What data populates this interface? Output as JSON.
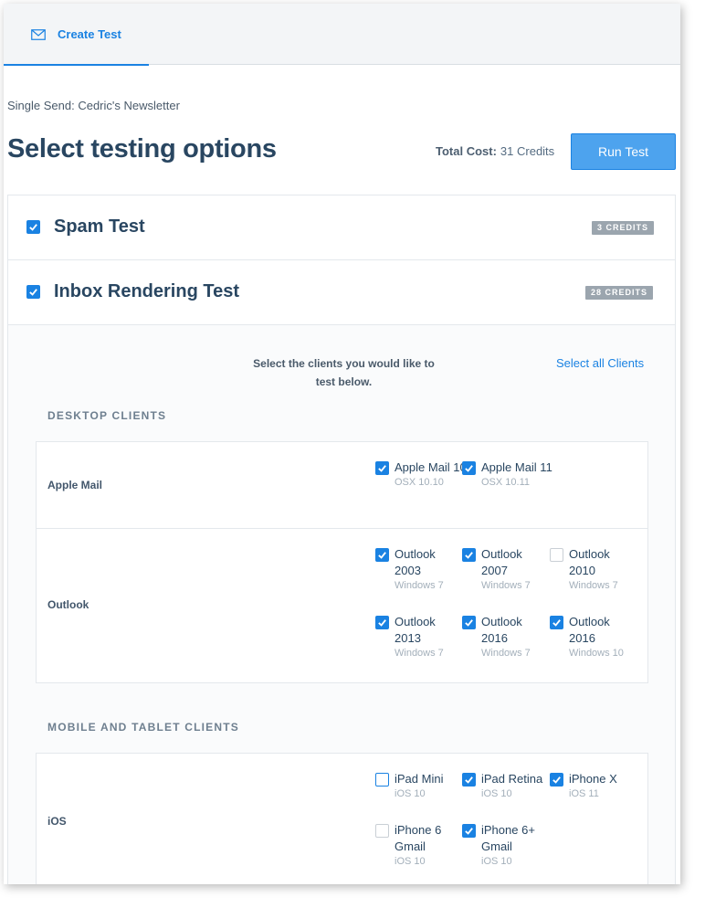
{
  "tab": {
    "label": "Create Test",
    "icon": "envelope-icon"
  },
  "subtitle": "Single Send: Cedric's Newsletter",
  "title": "Select testing options",
  "total_cost": {
    "label": "Total Cost:",
    "value": "31 Credits"
  },
  "run_button": "Run Test",
  "tests": [
    {
      "name": "Spam Test",
      "credits": "3 CREDITS",
      "checked": true
    },
    {
      "name": "Inbox Rendering Test",
      "credits": "28 CREDITS",
      "checked": true
    }
  ],
  "select_prompt_line1": "Select the clients you would like to",
  "select_prompt_line2": "test below.",
  "select_all": "Select all Clients",
  "desktop": {
    "heading": "DESKTOP CLIENTS",
    "clients": [
      {
        "name": "Apple Mail",
        "options": [
          {
            "label": "Apple Mail 10",
            "sub": "OSX 10.10",
            "checked": true
          },
          {
            "label": "Apple Mail 11",
            "sub": "OSX 10.11",
            "checked": true
          }
        ]
      },
      {
        "name": "Outlook",
        "options": [
          {
            "label": "Outlook 2003",
            "sub": "Windows 7",
            "checked": true
          },
          {
            "label": "Outlook 2007",
            "sub": "Windows 7",
            "checked": true
          },
          {
            "label": "Outlook 2010",
            "sub": "Windows 7",
            "checked": false
          },
          {
            "label": "Outlook 2013",
            "sub": "Windows 7",
            "checked": true
          },
          {
            "label": "Outlook 2016",
            "sub": "Windows 7",
            "checked": true
          },
          {
            "label": "Outlook 2016",
            "sub": "Windows 10",
            "checked": true
          }
        ]
      }
    ]
  },
  "mobile": {
    "heading": "MOBILE AND TABLET CLIENTS",
    "clients": [
      {
        "name": "iOS",
        "options": [
          {
            "label": "iPad Mini",
            "sub": "iOS 10",
            "checked": false
          },
          {
            "label": "iPad Retina",
            "sub": "iOS 10",
            "checked": true
          },
          {
            "label": "iPhone X",
            "sub": "iOS 11",
            "checked": true
          },
          {
            "label": "iPhone 6 Gmail",
            "sub": "iOS 10",
            "checked": false
          },
          {
            "label": "iPhone 6+ Gmail",
            "sub": "iOS 10",
            "checked": true
          }
        ]
      }
    ]
  },
  "colors": {
    "accent": "#1a82e2",
    "button": "#4da3ee",
    "badge": "#9ba5ae",
    "heading": "#294661"
  }
}
